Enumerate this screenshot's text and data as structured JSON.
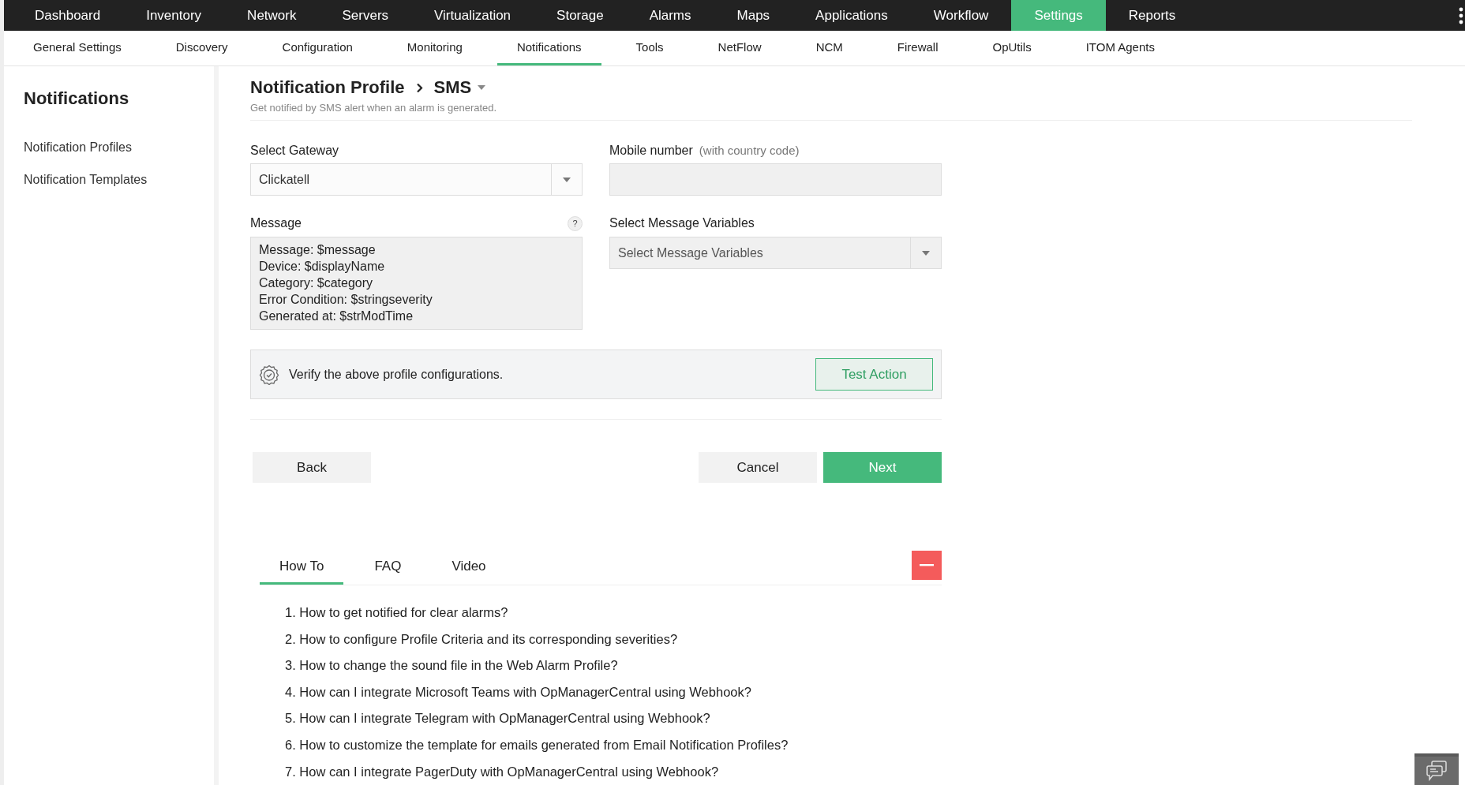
{
  "top_nav": [
    {
      "label": "Dashboard",
      "selected": false
    },
    {
      "label": "Inventory",
      "selected": false
    },
    {
      "label": "Network",
      "selected": false
    },
    {
      "label": "Servers",
      "selected": false
    },
    {
      "label": "Virtualization",
      "selected": false
    },
    {
      "label": "Storage",
      "selected": false
    },
    {
      "label": "Alarms",
      "selected": false
    },
    {
      "label": "Maps",
      "selected": false
    },
    {
      "label": "Applications",
      "selected": false
    },
    {
      "label": "Workflow",
      "selected": false
    },
    {
      "label": "Settings",
      "selected": true
    },
    {
      "label": "Reports",
      "selected": false
    }
  ],
  "sub_nav": [
    {
      "label": "General Settings",
      "selected": false
    },
    {
      "label": "Discovery",
      "selected": false
    },
    {
      "label": "Configuration",
      "selected": false
    },
    {
      "label": "Monitoring",
      "selected": false
    },
    {
      "label": "Notifications",
      "selected": true
    },
    {
      "label": "Tools",
      "selected": false
    },
    {
      "label": "NetFlow",
      "selected": false
    },
    {
      "label": "NCM",
      "selected": false
    },
    {
      "label": "Firewall",
      "selected": false
    },
    {
      "label": "OpUtils",
      "selected": false
    },
    {
      "label": "ITOM Agents",
      "selected": false
    }
  ],
  "sidebar": {
    "title": "Notifications",
    "items": [
      "Notification Profiles",
      "Notification Templates"
    ]
  },
  "header": {
    "breadcrumb": "Notification Profile",
    "current": "SMS",
    "subtitle": "Get notified by SMS alert when an alarm is generated."
  },
  "form": {
    "gateway": {
      "label": "Select Gateway",
      "value": "Clickatell"
    },
    "mobile": {
      "label": "Mobile number",
      "hint": "(with country code)"
    },
    "message": {
      "label": "Message",
      "help": "?",
      "value": "Message: $message\nDevice: $displayName\nCategory: $category\nError Condition: $stringseverity\nGenerated at: $strModTime"
    },
    "variables": {
      "label": "Select Message Variables",
      "placeholder": "Select Message Variables"
    }
  },
  "verify": {
    "text": "Verify the above profile configurations.",
    "button": "Test Action"
  },
  "buttons": {
    "back": "Back",
    "cancel": "Cancel",
    "next": "Next"
  },
  "help_tabs": [
    {
      "label": "How To",
      "selected": true
    },
    {
      "label": "FAQ",
      "selected": false
    },
    {
      "label": "Video",
      "selected": false
    }
  ],
  "how_to": [
    "1. How to get notified for clear alarms?",
    "2. How to configure Profile Criteria and its corresponding severities?",
    "3. How to change the sound file in the Web Alarm Profile?",
    "4. How can I integrate Microsoft Teams with OpManagerCentral using Webhook?",
    "5. How can I integrate Telegram with OpManagerCentral using Webhook?",
    "6. How to customize the template for emails generated from Email Notification Profiles?",
    "7. How can I integrate PagerDuty with OpManagerCentral using Webhook?"
  ]
}
